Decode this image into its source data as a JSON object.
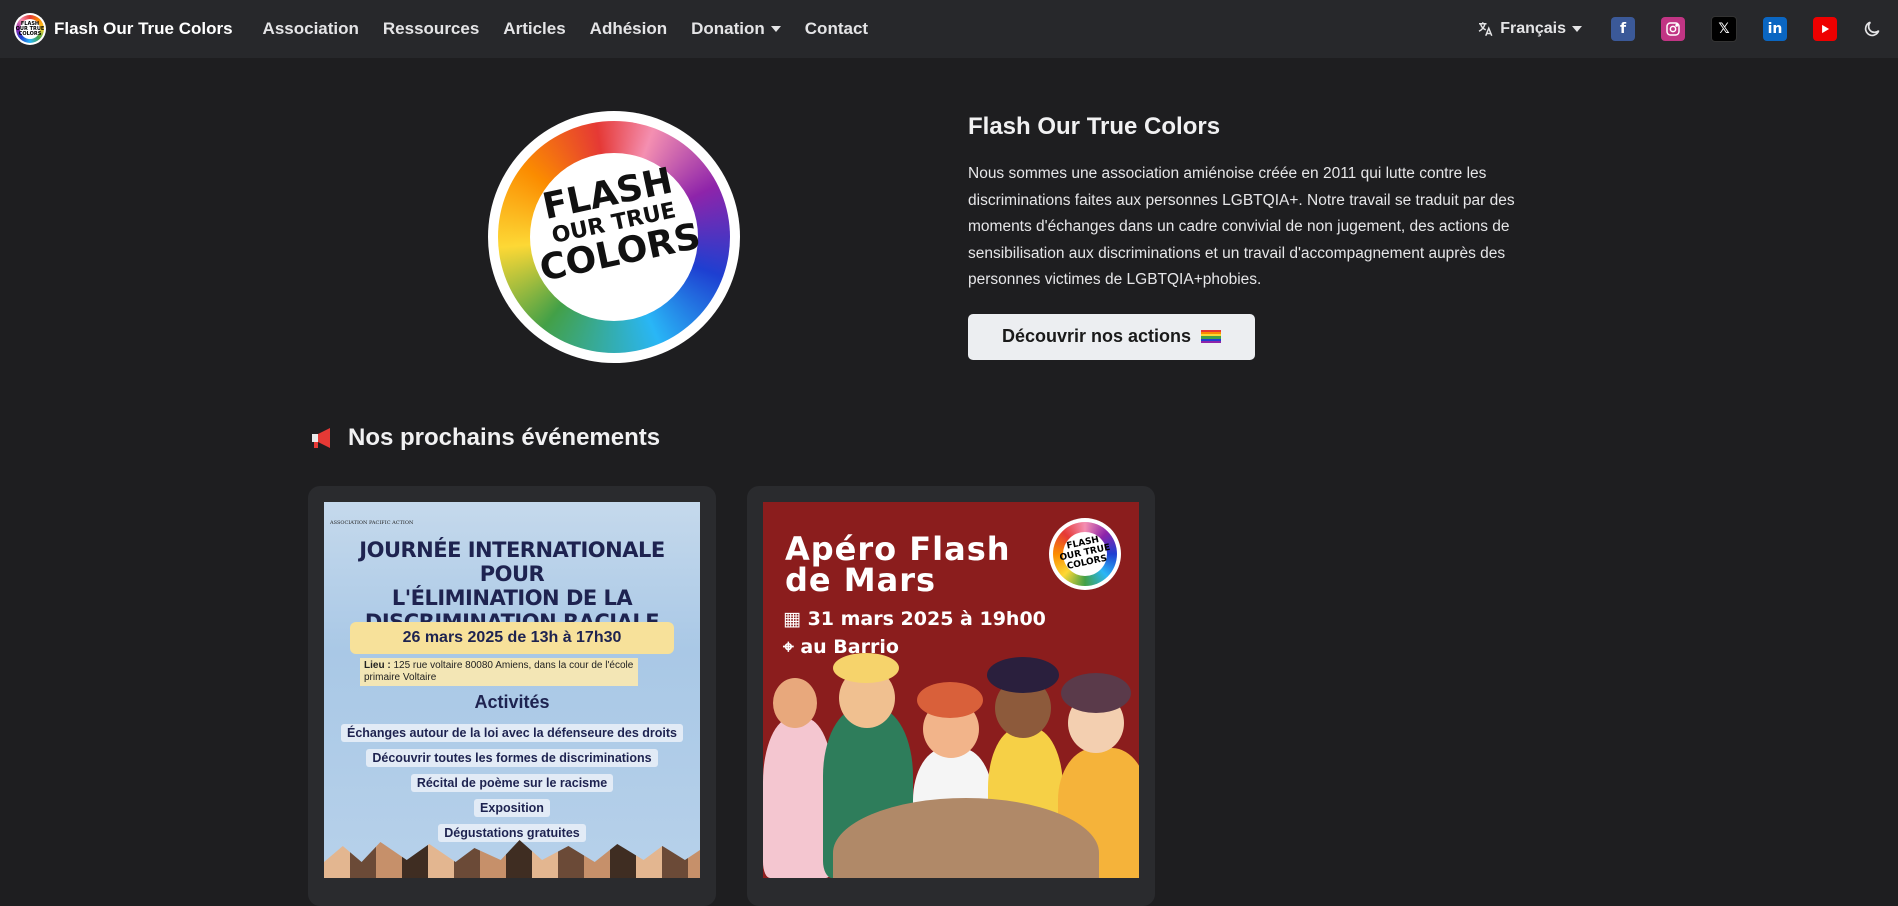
{
  "navbar": {
    "brand": "Flash Our True Colors",
    "logo_mini": [
      "FLASH",
      "OUR TRUE",
      "COLORS"
    ],
    "links": [
      {
        "label": "Association",
        "dropdown": false
      },
      {
        "label": "Ressources",
        "dropdown": false
      },
      {
        "label": "Articles",
        "dropdown": false
      },
      {
        "label": "Adhésion",
        "dropdown": false
      },
      {
        "label": "Donation",
        "dropdown": true
      },
      {
        "label": "Contact",
        "dropdown": false
      }
    ],
    "language": "Français",
    "social_icons": [
      "facebook-icon",
      "instagram-icon",
      "x-icon",
      "linkedin-icon",
      "youtube-icon"
    ],
    "theme_icon": "moon-icon"
  },
  "hero": {
    "logo_words": [
      "FLASH",
      "OUR TRUE",
      "COLORS"
    ],
    "title": "Flash Our True Colors",
    "description": "Nous sommes une association amiénoise créée en 2011 qui lutte contre les discriminations faites aux personnes LGBTQIA+. Notre travail se traduit par des moments d'échanges dans un cadre convivial de non jugement, des actions de sensibilisation aux discriminations et un travail d'accompagnement auprès des personnes victimes de LGBTQIA+phobies.",
    "cta_label": "Découvrir nos actions"
  },
  "events": {
    "heading": "Nos prochains événements",
    "cards": [
      {
        "org": "ASSOCIATION PACIFIC ACTION",
        "headline": [
          "JOURNÉE INTERNATIONALE POUR",
          "L'ÉLIMINATION DE LA",
          "DISCRIMINATION RACIALE"
        ],
        "date": "26 mars 2025 de 13h à 17h30",
        "lieu_label": "Lieu :",
        "lieu_text": "125 rue voltaire 80080 Amiens, dans la cour de l'école primaire Voltaire",
        "activities_title": "Activités",
        "activities": [
          "Échanges autour de la loi avec la défenseure des droits",
          "Découvrir toutes les formes de discriminations",
          "Récital de poème sur le racisme",
          "Exposition",
          "Dégustations gratuites"
        ]
      },
      {
        "title": [
          "Apéro Flash",
          "de Mars"
        ],
        "date": "31 mars 2025 à 19h00",
        "location": "au Barrio",
        "logo_words": [
          "FLASH",
          "OUR TRUE",
          "COLORS"
        ]
      }
    ]
  },
  "colors": {
    "background": "#1e1e20",
    "navbar": "#27282b",
    "card": "#2a2b2e",
    "cta_bg": "#eceef1",
    "poster2_bg": "#8b1d1d",
    "rainbow": [
      "#e53935",
      "#fb8c00",
      "#fdd835",
      "#43a047",
      "#1e3fd1",
      "#8e24aa"
    ]
  }
}
